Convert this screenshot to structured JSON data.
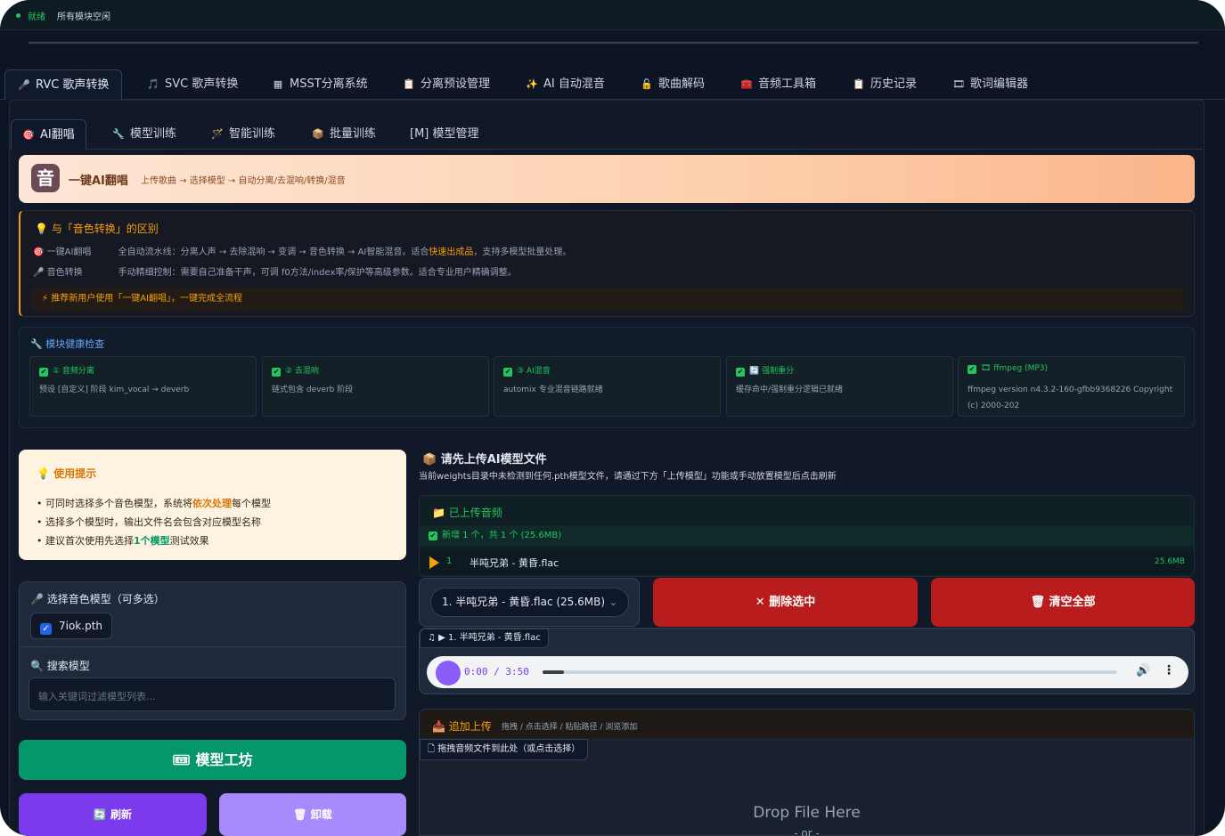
{
  "status": {
    "state": "就绪",
    "message": "所有模块空闲"
  },
  "main_tabs": [
    {
      "icon": "🎤",
      "label": "RVC 歌声转换"
    },
    {
      "icon": "🎵",
      "label": "SVC 歌声转换"
    },
    {
      "icon": "▦",
      "label": "MSST分离系统"
    },
    {
      "icon": "📋",
      "label": "分离预设管理"
    },
    {
      "icon": "✨",
      "label": "AI 自动混音"
    },
    {
      "icon": "🔓",
      "label": "歌曲解码"
    },
    {
      "icon": "🧰",
      "label": "音频工具箱"
    },
    {
      "icon": "📋",
      "label": "历史记录"
    },
    {
      "icon": "🎞",
      "label": "歌词编辑器"
    }
  ],
  "sub_tabs": [
    {
      "icon": "🎯",
      "label": "AI翻唱"
    },
    {
      "icon": "🔧",
      "label": "模型训练"
    },
    {
      "icon": "🪄",
      "label": "智能训练"
    },
    {
      "icon": "📦",
      "label": "批量训练"
    },
    {
      "icon": "",
      "label": "[M] 模型管理"
    }
  ],
  "hero": {
    "logo": "音",
    "title": "一键AI翻唱",
    "subtitle": "上传歌曲 → 选择模型 → 自动分离/去混响/转换/混音"
  },
  "diff": {
    "title": "与「音色转换」的区别",
    "rows": [
      {
        "icon": "🎯",
        "key": "一键AI翻唱",
        "text_a": "全自动流水线：分离人声 → 去除混响 → 变调 → 音色转换 → AI智能混音。适合",
        "highlight": "快速出成品",
        "text_b": "，支持多模型批量处理。"
      },
      {
        "icon": "🎤",
        "key": "音色转换",
        "text_a": "手动精细控制：需要自己准备干声，可调 f0方法/index率/保护等高级参数。适合专业用户精确调整。",
        "highlight": "",
        "text_b": ""
      }
    ],
    "tip": "推荐新用户使用「一键AI翻唱」，一键完成全流程"
  },
  "health": {
    "title": "模块健康检查",
    "cards": [
      {
        "title": "① 音频分离",
        "desc": "预设 [自定义] 阶段 kim_vocal → deverb"
      },
      {
        "title": "② 去混响",
        "desc": "链式包含 deverb 阶段"
      },
      {
        "title": "③ AI混音",
        "desc": "automix 专业混音链路就绪"
      },
      {
        "title": "🔄 强制重分",
        "desc": "缓存命中/强制重分逻辑已就绪"
      },
      {
        "title": "🎞 ffmpeg (MP3)",
        "desc": "ffmpeg version n4.3.2-160-gfbb9368226 Copyright (c) 2000-202"
      }
    ]
  },
  "tips": {
    "title": "使用提示",
    "line1_a": "• 可同时选择多个音色模型，系统将",
    "line1_hl": "依次处理",
    "line1_b": "每个模型",
    "line2": "• 选择多个模型时，输出文件名会包含对应模型名称",
    "line3_a": "• 建议首次使用先选择",
    "line3_hl": "1个模型",
    "line3_b": "测试效果"
  },
  "models": {
    "title": "选择音色模型（可多选）",
    "items": [
      "7iok.pth"
    ]
  },
  "search": {
    "title": "搜索模型",
    "placeholder": "输入关键词过滤模型列表..."
  },
  "buttons": {
    "workshop": "模型工坊",
    "refresh": "刷新",
    "unload": "卸载",
    "delete": "删除选中",
    "clear": "清空全部"
  },
  "upload": {
    "title": "请先上传AI模型文件",
    "desc": "当前weights目录中未检测到任何.pth模型文件，请通过下方「上传模型」功能或手动放置模型后点击刷新"
  },
  "files": {
    "title": "已上传音频",
    "added": "新增 1 个，共 1 个 (25.6MB)",
    "list": [
      {
        "index": "1",
        "name": "半吨兄弟 - 黄昏.flac",
        "size": "25.6MB"
      }
    ]
  },
  "file_select": {
    "value": "1. 半吨兄弟 - 黄昏.flac (25.6MB)"
  },
  "player": {
    "label": "▶ 1. 半吨兄弟 - 黄昏.flac",
    "time": "0:00 / 3:50",
    "progress": 0.0
  },
  "append": {
    "title": "追加上传",
    "subtitle": "拖拽 / 点击选择 / 粘贴路径 / 浏览添加",
    "label": "拖拽音频文件到此处（或点击选择）",
    "drop": "Drop File Here",
    "or": "- or -"
  },
  "colors": {
    "accent_green": "#22c55e",
    "accent_orange": "#f59e0b",
    "danger": "#b91c1c",
    "purple": "#7c3aed",
    "emerald": "#059669"
  }
}
